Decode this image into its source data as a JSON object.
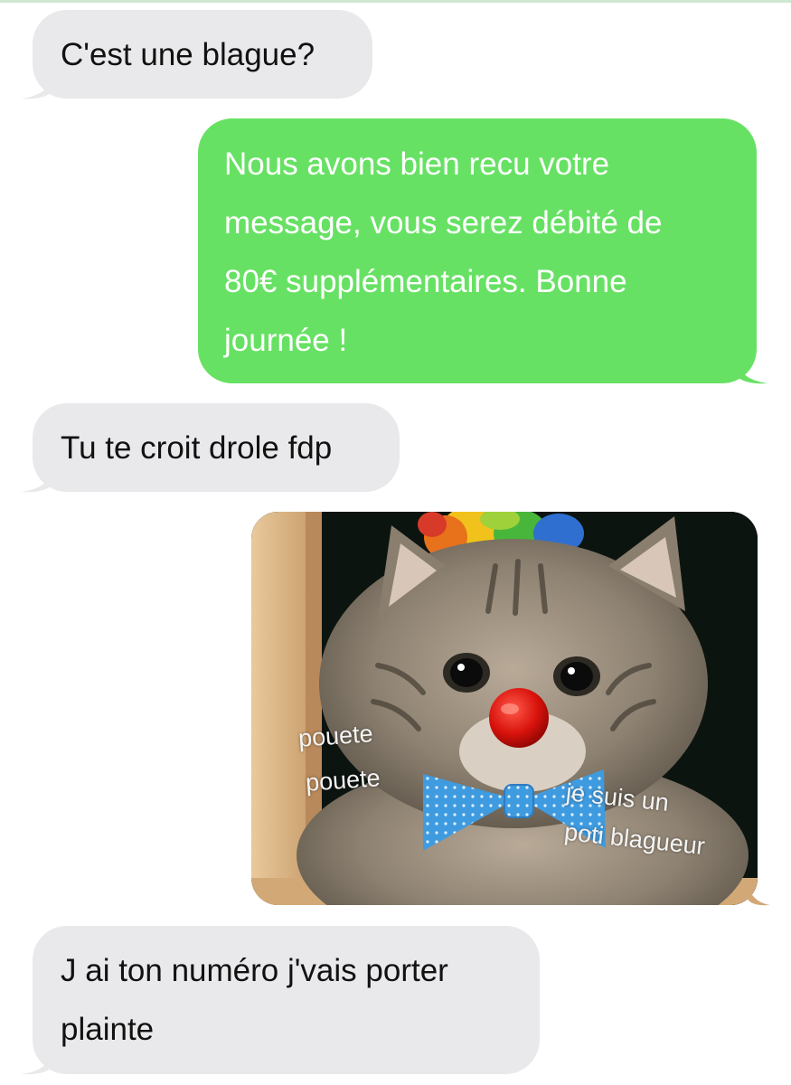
{
  "messages": [
    {
      "direction": "received",
      "text": "C'est une blague?"
    },
    {
      "direction": "sent",
      "lines": [
        "Nous avons bien recu votre",
        "message, vous serez débité de",
        "80€ supplémentaires. Bonne",
        "journée !"
      ]
    },
    {
      "direction": "received",
      "text": "Tu te croit drole fdp"
    },
    {
      "direction": "sent",
      "type": "image",
      "image_subject": "tabby cat dressed as a clown with red nose, rainbow wig and blue polka-dot bow tie",
      "captions": [
        "pouete",
        "pouete",
        "je suis un",
        "poti blagueur"
      ]
    },
    {
      "direction": "received",
      "lines": [
        "J ai ton numéro j'vais porter",
        "plainte"
      ]
    }
  ],
  "colors": {
    "received_bubble": "#e9e9eb",
    "sent_bubble": "#67e164",
    "received_text": "#111111",
    "sent_text": "#ffffff"
  }
}
